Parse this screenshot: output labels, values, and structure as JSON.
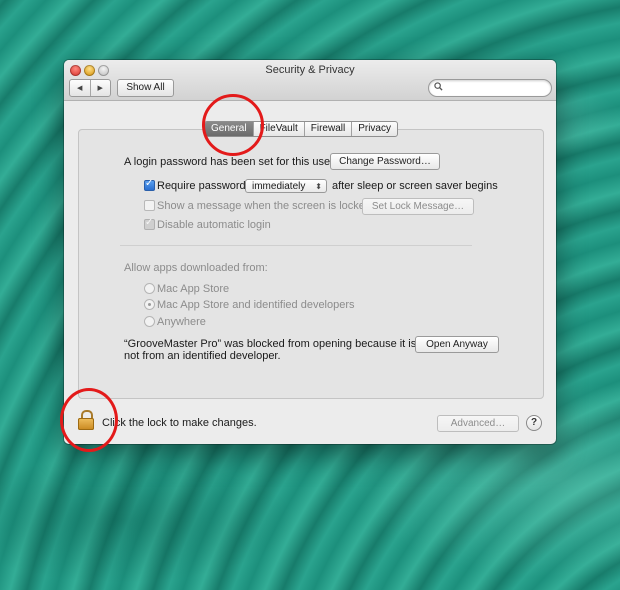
{
  "window": {
    "title": "Security & Privacy",
    "show_all_label": "Show All",
    "search_placeholder": "",
    "nav_back": "◀",
    "nav_forward": "▶"
  },
  "tabs": [
    {
      "label": "General",
      "active": true
    },
    {
      "label": "FileVault",
      "active": false
    },
    {
      "label": "Firewall",
      "active": false
    },
    {
      "label": "Privacy",
      "active": false
    }
  ],
  "general": {
    "login_password_text": "A login password has been set for this user",
    "change_password_label": "Change Password…",
    "require_password_label": "Require password",
    "require_password_checked": true,
    "require_password_value": "immediately",
    "after_sleep_text": "after sleep or screen saver begins",
    "show_message_label": "Show a message when the screen is locked",
    "show_message_checked": false,
    "set_lock_message_label": "Set Lock Message…",
    "disable_autologin_label": "Disable automatic login",
    "disable_autologin_checked": true,
    "allow_apps_label": "Allow apps downloaded from:",
    "options": [
      {
        "label": "Mac App Store",
        "selected": false
      },
      {
        "label": "Mac App Store and identified developers",
        "selected": true
      },
      {
        "label": "Anywhere",
        "selected": false
      }
    ],
    "blocked_line1": "“GrooveMaster Pro” was blocked from opening because it is",
    "blocked_line2": "not from an identified developer.",
    "open_anyway_label": "Open Anyway"
  },
  "footer": {
    "lock_text": "Click the lock to make changes.",
    "advanced_label": "Advanced…",
    "help_label": "?"
  },
  "colors": {
    "annotation": "#e31a1a",
    "active_tab": "#7a7a7a",
    "lock": "#e0a23a"
  }
}
